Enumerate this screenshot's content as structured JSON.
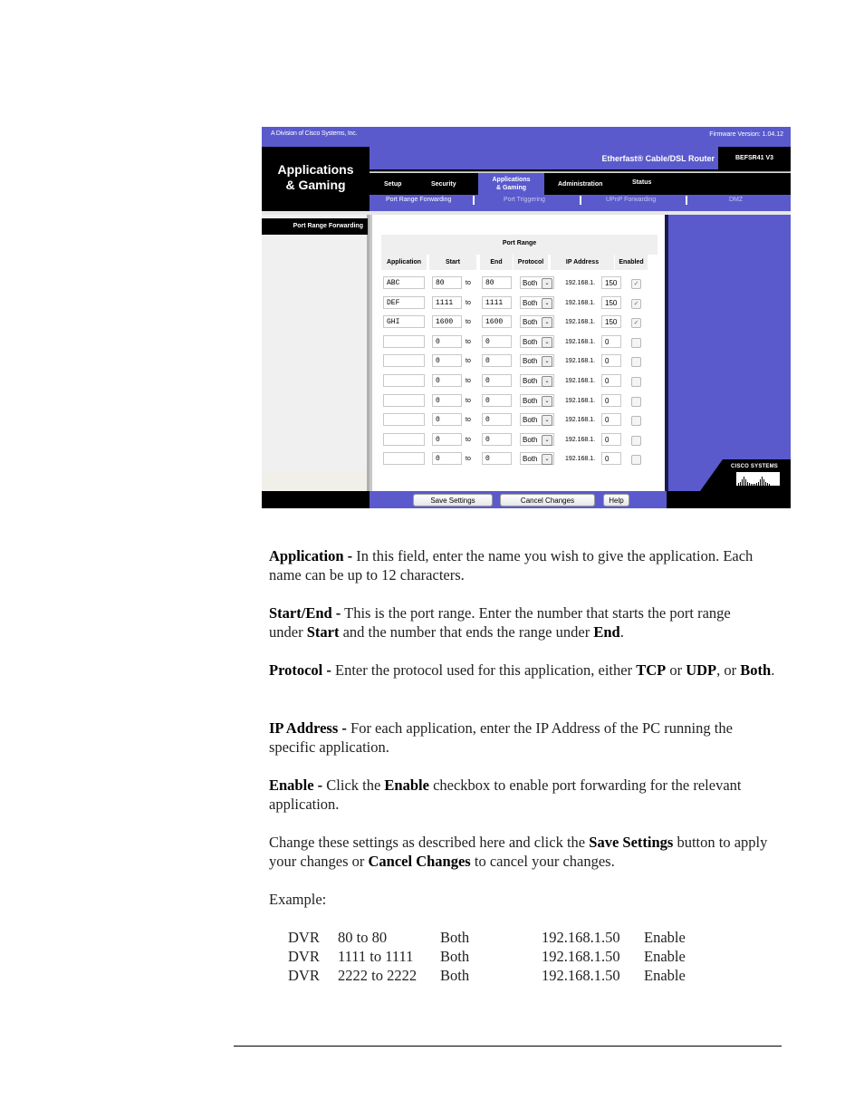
{
  "router": {
    "division": "A Division of Cisco Systems, Inc.",
    "firmware": "Firmware Version: 1.04.12",
    "section_title_line1": "Applications",
    "section_title_line2": "& Gaming",
    "product_name": "Etherfast® Cable/DSL Router",
    "model": "BEFSR41 V3",
    "tabs": [
      {
        "label": "Setup"
      },
      {
        "label": "Security"
      },
      {
        "label_line1": "Applications",
        "label_line2": "& Gaming",
        "active": true
      },
      {
        "label": "Administration"
      },
      {
        "label": "Status"
      }
    ],
    "subtabs": [
      {
        "label": "Port Range Forwarding",
        "active": true
      },
      {
        "label": "Port Triggering"
      },
      {
        "label": "UPnP Forwarding"
      },
      {
        "label": "DMZ"
      }
    ],
    "left_nav_active": "Port Range Forwarding",
    "table": {
      "group_header": "Port Range",
      "columns": [
        "Application",
        "Start",
        "End",
        "Protocol",
        "IP Address",
        "Enabled"
      ],
      "to_label": "to",
      "ip_prefix": "192.168.1.",
      "rows": [
        {
          "application": "ABC",
          "start": "80",
          "end": "80",
          "protocol": "Both",
          "ip_last": "150",
          "enabled": true
        },
        {
          "application": "DEF",
          "start": "1111",
          "end": "1111",
          "protocol": "Both",
          "ip_last": "150",
          "enabled": true
        },
        {
          "application": "GHI",
          "start": "1600",
          "end": "1600",
          "protocol": "Both",
          "ip_last": "150",
          "enabled": true
        },
        {
          "application": "",
          "start": "0",
          "end": "0",
          "protocol": "Both",
          "ip_last": "0",
          "enabled": false
        },
        {
          "application": "",
          "start": "0",
          "end": "0",
          "protocol": "Both",
          "ip_last": "0",
          "enabled": false
        },
        {
          "application": "",
          "start": "0",
          "end": "0",
          "protocol": "Both",
          "ip_last": "0",
          "enabled": false
        },
        {
          "application": "",
          "start": "0",
          "end": "0",
          "protocol": "Both",
          "ip_last": "0",
          "enabled": false
        },
        {
          "application": "",
          "start": "0",
          "end": "0",
          "protocol": "Both",
          "ip_last": "0",
          "enabled": false
        },
        {
          "application": "",
          "start": "0",
          "end": "0",
          "protocol": "Both",
          "ip_last": "0",
          "enabled": false
        },
        {
          "application": "",
          "start": "0",
          "end": "0",
          "protocol": "Both",
          "ip_last": "0",
          "enabled": false
        }
      ]
    },
    "buttons": {
      "save": "Save Settings",
      "cancel": "Cancel Changes",
      "help": "Help"
    },
    "logo_text": "Cisco Systems",
    "colors": {
      "brand_purple": "#5a5acd",
      "black": "#000000"
    }
  },
  "doc": {
    "application": {
      "term": "Application -",
      "text": " In this field, enter the name you wish to give the application. Each name can be up to 12 characters."
    },
    "startend": {
      "term": "Start/End -",
      "t1": " This is the port range. Enter the number that starts the port range under ",
      "b1": "Start",
      "t2": " and the number that ends the range under ",
      "b2": "End",
      "t3": "."
    },
    "protocol": {
      "term": "Protocol -",
      "t1": " Enter the protocol used for this application, either ",
      "b1": "TCP",
      "t2": " or ",
      "b2": "UDP",
      "t3": ", or ",
      "b3": "Both",
      "t4": "."
    },
    "ipaddress": {
      "term": "IP Address -",
      "text": " For each application, enter the IP Address of the PC running the specific application."
    },
    "enable": {
      "term": "Enable -",
      "t1": " Click the ",
      "b1": "Enable",
      "t2": " checkbox to enable port forwarding for the relevant application."
    },
    "change": {
      "t1": "Change these settings as described here and click the ",
      "b1": "Save Settings",
      "t2": " button to apply your changes or ",
      "b2": "Cancel Changes",
      "t3": " to cancel your changes."
    },
    "example_label": "Example:",
    "examples": [
      {
        "name": "DVR",
        "range": "80 to 80",
        "protocol": "Both",
        "ip": "192.168.1.50",
        "status": "Enable"
      },
      {
        "name": "DVR",
        "range": "1111 to 1111",
        "protocol": "Both",
        "ip": "192.168.1.50",
        "status": "Enable"
      },
      {
        "name": "DVR",
        "range": "2222 to 2222",
        "protocol": "Both",
        "ip": "192.168.1.50",
        "status": "Enable"
      }
    ]
  }
}
